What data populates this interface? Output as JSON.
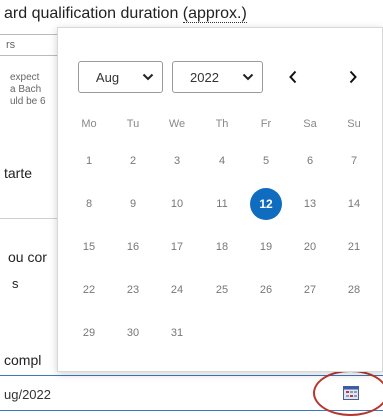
{
  "form": {
    "title_prefix": "ard qualification duration ",
    "title_dotted": "(approx.)",
    "info_box_text": "rs",
    "note_lines": [
      "expect",
      "a Bach",
      "uld be 6"
    ],
    "label_started": "tarte",
    "label_complete_question": "ou cor",
    "answer_text": "s",
    "label_completion": "compl",
    "date_value": "ug/2022"
  },
  "calendar": {
    "month_selected": "Aug",
    "year_selected": "2022",
    "weekdays": [
      "Mo",
      "Tu",
      "We",
      "Th",
      "Fr",
      "Sa",
      "Su"
    ],
    "weeks": [
      [
        "1",
        "2",
        "3",
        "4",
        "5",
        "6",
        "7"
      ],
      [
        "8",
        "9",
        "10",
        "11",
        "12",
        "13",
        "14"
      ],
      [
        "15",
        "16",
        "17",
        "18",
        "19",
        "20",
        "21"
      ],
      [
        "22",
        "23",
        "24",
        "25",
        "26",
        "27",
        "28"
      ],
      [
        "29",
        "30",
        "31",
        "",
        "",
        "",
        ""
      ]
    ],
    "selected_day": "12",
    "prev_icon": "chevron-left-icon",
    "next_icon": "chevron-right-icon"
  },
  "colors": {
    "accent": "#0f6cbf",
    "highlight_circle": "#b8362f",
    "input_border": "#3b78c2"
  }
}
